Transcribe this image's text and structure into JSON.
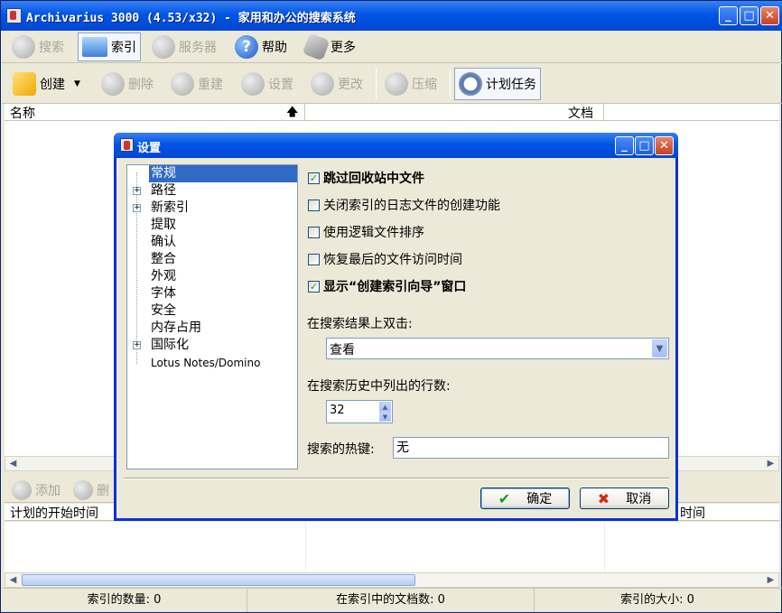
{
  "window": {
    "title": "Archivarius 3000 (4.53/x32) - 家用和办公的搜索系统"
  },
  "toolbar_main": [
    {
      "label": "搜索",
      "icon": "search-icon",
      "disabled": true
    },
    {
      "label": "索引",
      "icon": "folder-icon",
      "active": true
    },
    {
      "label": "服务器",
      "icon": "server-icon",
      "disabled": true
    },
    {
      "label": "帮助",
      "icon": "help-icon"
    },
    {
      "label": "更多",
      "icon": "wrench-icon"
    }
  ],
  "toolbar_index": [
    {
      "label": "创建",
      "icon": "create-icon"
    },
    {
      "label": "删除",
      "icon": "delete-icon",
      "disabled": true
    },
    {
      "label": "重建",
      "icon": "rebuild-icon",
      "disabled": true
    },
    {
      "label": "设置",
      "icon": "settings-icon",
      "disabled": true
    },
    {
      "label": "更改",
      "icon": "edit-icon",
      "disabled": true
    },
    {
      "label": "压缩",
      "icon": "compress-icon",
      "disabled": true
    },
    {
      "label": "计划任务",
      "icon": "schedule-icon",
      "active": true
    }
  ],
  "columns": {
    "name": "名称",
    "documents": "文档",
    "sort_glyph": "🡅"
  },
  "lower_toolbar": {
    "add": "添加",
    "remove": "删"
  },
  "lower_columns": {
    "start_time": "计划的开始时间",
    "right_partial": "时间"
  },
  "status": {
    "index_count": "索引的数量: 0",
    "doc_count": "在索引中的文档数: 0",
    "index_size": "索引的大小: 0"
  },
  "dialog": {
    "title": "设置",
    "tree": [
      {
        "label": "常规",
        "selected": true,
        "expandable": false
      },
      {
        "label": "路径",
        "expandable": true
      },
      {
        "label": "新索引",
        "expandable": true
      },
      {
        "label": "提取"
      },
      {
        "label": "确认"
      },
      {
        "label": "整合"
      },
      {
        "label": "外观"
      },
      {
        "label": "字体"
      },
      {
        "label": "安全"
      },
      {
        "label": "内存占用"
      },
      {
        "label": "国际化",
        "expandable": true
      },
      {
        "label": "Lotus Notes/Domino"
      }
    ],
    "options": [
      {
        "label": "跳过回收站中文件",
        "checked": true,
        "bold": true
      },
      {
        "label": "关闭索引的日志文件的创建功能",
        "checked": false
      },
      {
        "label": "使用逻辑文件排序",
        "checked": false
      },
      {
        "label": "恢复最后的文件访问时间",
        "checked": false
      },
      {
        "label": "显示“创建索引向导”窗口",
        "checked": true,
        "bold": true
      }
    ],
    "dblclick_label": "在搜索结果上双击:",
    "dblclick_value": "查看",
    "history_label": "在搜索历史中列出的行数:",
    "history_value": "32",
    "hotkey_label": "搜索的热键:",
    "hotkey_value": "无",
    "ok": "确定",
    "cancel": "取消"
  }
}
